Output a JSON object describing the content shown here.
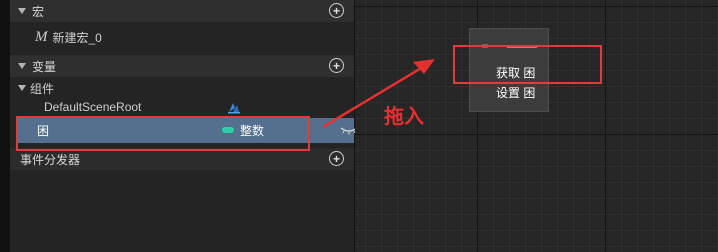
{
  "panel": {
    "macros_section": {
      "label": "宏",
      "item": "新建宏_0",
      "macro_glyph": "M"
    },
    "variables_section": {
      "label": "变量"
    },
    "components_group": {
      "label": "组件",
      "item": "DefaultSceneRoot"
    },
    "selected_variable": {
      "name": "困",
      "type": "整数",
      "type_color": "#2bd3a4"
    },
    "dispatchers_section": {
      "label": "事件分发器"
    },
    "plus_symbol": "+"
  },
  "canvas": {
    "context_menu": {
      "get_item": "获取 困",
      "set_item": "设置 困"
    },
    "annotation": {
      "text": "拖入",
      "color": "#e53030"
    }
  },
  "icons": [
    "expand-arrow-icon",
    "add-icon",
    "macro-icon",
    "scene-component-icon",
    "visibility-eye-icon",
    "drag-arrow-icon"
  ]
}
